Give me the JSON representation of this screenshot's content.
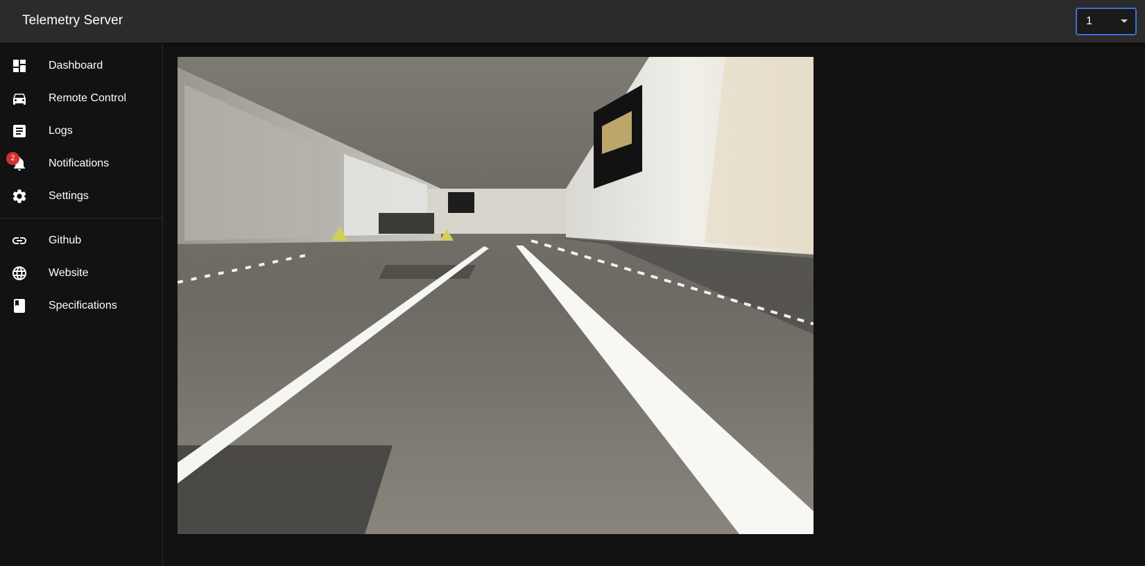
{
  "app": {
    "title": "Telemetry Server"
  },
  "vehicle_select": {
    "value": "1"
  },
  "sidebar": {
    "items": [
      {
        "label": "Dashboard",
        "icon": "dashboard-icon"
      },
      {
        "label": "Remote Control",
        "icon": "car-icon"
      },
      {
        "label": "Logs",
        "icon": "article-icon"
      },
      {
        "label": "Notifications",
        "icon": "bell-icon",
        "badge": "2"
      },
      {
        "label": "Settings",
        "icon": "gear-icon"
      }
    ],
    "links": [
      {
        "label": "Github",
        "icon": "link-icon"
      },
      {
        "label": "Website",
        "icon": "globe-icon"
      },
      {
        "label": "Specifications",
        "icon": "book-icon"
      }
    ]
  },
  "main": {
    "camera_feed": {
      "kind": "camera image"
    }
  },
  "colors": {
    "appbar": "#2b2b2b",
    "background": "#121212",
    "select_border": "#3d6fd6",
    "badge": "#d32f2f"
  }
}
